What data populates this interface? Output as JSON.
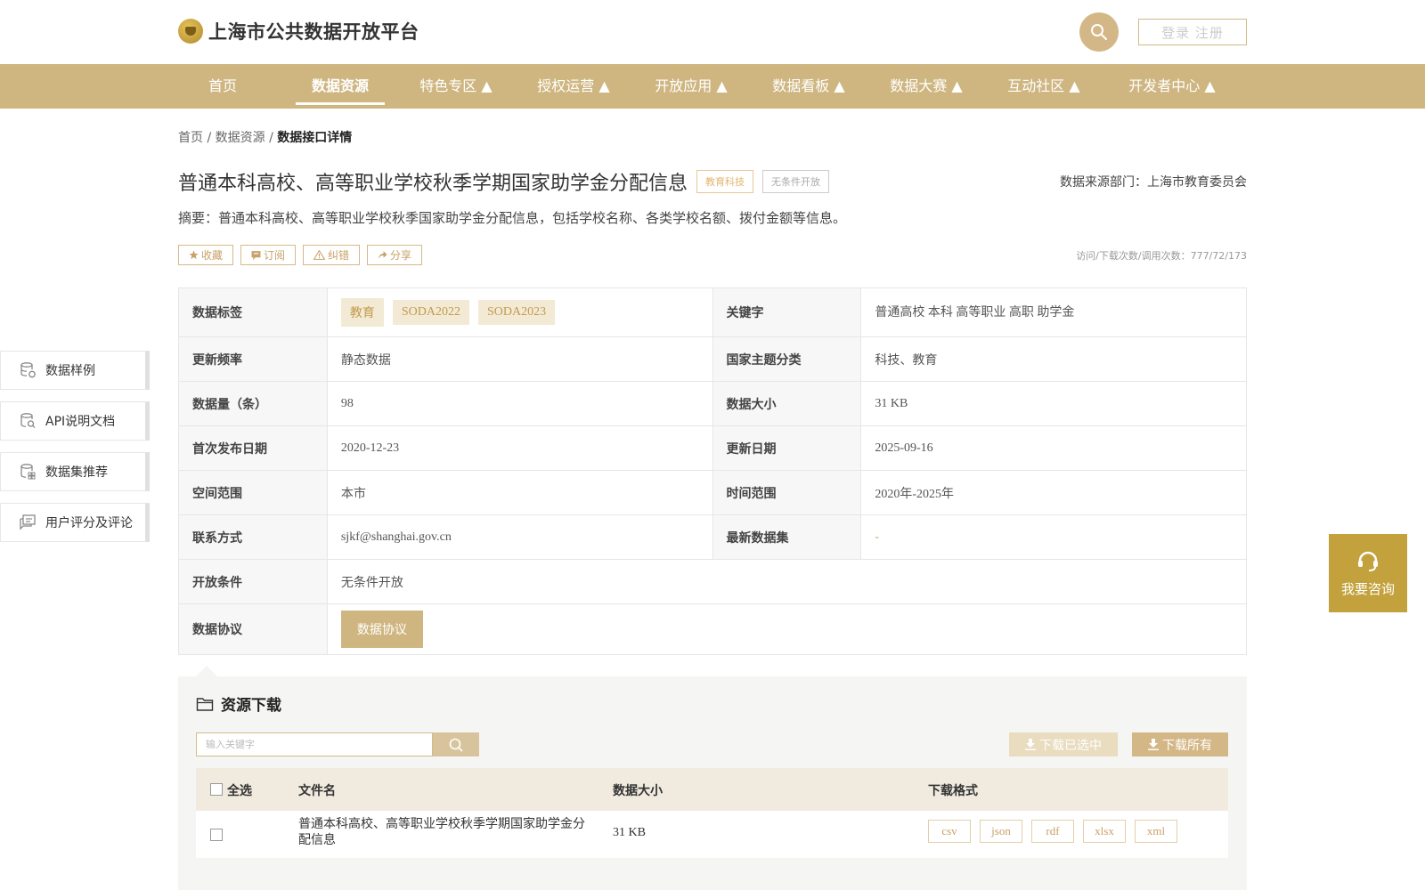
{
  "header": {
    "site_title": "上海市公共数据开放平台",
    "login_label": "登录 注册"
  },
  "nav": {
    "items": [
      {
        "label": "首页"
      },
      {
        "label": "数据资源"
      },
      {
        "label": "特色专区 ▲"
      },
      {
        "label": "授权运营 ▲"
      },
      {
        "label": "开放应用 ▲"
      },
      {
        "label": "数据看板 ▲"
      },
      {
        "label": "数据大赛 ▲"
      },
      {
        "label": "互动社区 ▲"
      },
      {
        "label": "开发者中心 ▲"
      }
    ],
    "active_index": 1
  },
  "breadcrumb": {
    "home": "首页",
    "sep1": " / ",
    "resources": "数据资源",
    "sep2": " / ",
    "current": "数据接口详情"
  },
  "dataset": {
    "title": "普通本科高校、高等职业学校秋季学期国家助学金分配信息",
    "tag_category": "教育科技",
    "tag_open": "无条件开放",
    "source_dept": "数据来源部门：上海市教育委员会",
    "summary": "摘要：普通本科高校、高等职业学校秋季国家助学金分配信息，包括学校名称、各类学校名额、拨付金额等信息。",
    "actions": {
      "favorite": "收藏",
      "subscribe": "订阅",
      "report": "纠错",
      "share": "分享"
    },
    "stats": "访问/下载次数/调用次数：777/72/173"
  },
  "info": {
    "labels": {
      "tags": "数据标签",
      "keywords": "关键字",
      "frequency": "更新频率",
      "theme": "国家主题分类",
      "count": "数据量（条）",
      "size": "数据大小",
      "first_pub": "首次发布日期",
      "updated": "更新日期",
      "space": "空间范围",
      "time": "时间范围",
      "contact": "联系方式",
      "latest": "最新数据集",
      "condition": "开放条件",
      "protocol": "数据协议"
    },
    "tags": [
      "教育",
      "SODA2022",
      "SODA2023"
    ],
    "keywords": "普通高校 本科 高等职业 高职 助学金",
    "frequency": "静态数据",
    "theme": "科技、教育",
    "count": "98",
    "size": "31 KB",
    "first_pub": "2020-12-23",
    "updated": "2025-09-16",
    "space": "本市",
    "time": "2020年-2025年",
    "contact": "sjkf@shanghai.gov.cn",
    "latest": "-",
    "condition": "无条件开放",
    "protocol_button": "数据协议"
  },
  "sidebar": {
    "items": [
      {
        "label": "数据样例",
        "icon": "database-icon"
      },
      {
        "label": "API说明文档",
        "icon": "doc-search-icon"
      },
      {
        "label": "数据集推荐",
        "icon": "database-grid-icon"
      },
      {
        "label": "用户评分及评论",
        "icon": "comment-icon"
      }
    ]
  },
  "consult": {
    "label": "我要咨询",
    "icon": "headset-icon"
  },
  "resources": {
    "title": "资源下载",
    "search_placeholder": "输入关键字",
    "download_selected": "下载已选中",
    "download_all": "下载所有",
    "columns": {
      "select_all": "全选",
      "filename": "文件名",
      "size": "数据大小",
      "formats": "下载格式"
    },
    "rows": [
      {
        "filename": "普通本科高校、高等职业学校秋季学期国家助学金分配信息",
        "size": "31 KB",
        "formats": [
          "csv",
          "json",
          "rdf",
          "xlsx",
          "xml"
        ]
      }
    ]
  },
  "colors": {
    "nav_bg": "#cfb681",
    "accent": "#d4b787",
    "consult_bg": "#c3a23d"
  }
}
